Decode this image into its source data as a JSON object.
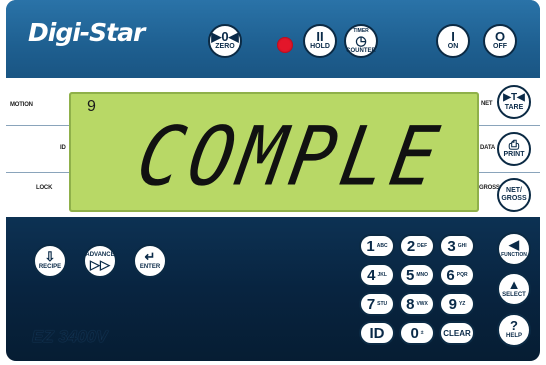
{
  "brand": {
    "logo": "Digi-Star"
  },
  "top_buttons": {
    "zero": {
      "symbol": "▶0◀",
      "label": "ZERO"
    },
    "hold": {
      "symbol": "II",
      "label": "HOLD"
    },
    "timer": {
      "top": "TIMER",
      "label": "COUNTER"
    },
    "on": {
      "symbol": "I",
      "label": "ON"
    },
    "off": {
      "symbol": "O",
      "label": "OFF"
    }
  },
  "indicators": {
    "motion": "MOTION",
    "id": "ID",
    "lock": "LOCK",
    "net": "NET",
    "data": "DATA",
    "gross": "GROSS"
  },
  "display": {
    "small_digit": "9",
    "main_text": "COMPLE"
  },
  "right_buttons": {
    "tare": {
      "symbol": "▶T◀",
      "label": "TARE"
    },
    "print": {
      "symbol": "⎙",
      "label": "PRINT"
    },
    "netgross": {
      "top": "NET/",
      "label": "GROSS"
    }
  },
  "bottom_left_buttons": {
    "recipe": {
      "symbol": "⇩",
      "label": "RECIPE"
    },
    "advance": {
      "top": "ADVANCE",
      "symbol": "▷▷"
    },
    "enter": {
      "symbol": "↵",
      "label": "ENTER"
    }
  },
  "keypad": [
    {
      "n": "1",
      "s": "ABC"
    },
    {
      "n": "2",
      "s": "DEF"
    },
    {
      "n": "3",
      "s": "GHI"
    },
    {
      "n": "4",
      "s": "JKL"
    },
    {
      "n": "5",
      "s": "MNO"
    },
    {
      "n": "6",
      "s": "PQR"
    },
    {
      "n": "7",
      "s": "STU"
    },
    {
      "n": "8",
      "s": "VWX"
    },
    {
      "n": "9",
      "s": "YZ"
    },
    {
      "n": "ID",
      "s": ""
    },
    {
      "n": "0",
      "s": "±"
    },
    {
      "n": "CLEAR",
      "s": ""
    }
  ],
  "side_buttons": {
    "function": {
      "symbol": "◀",
      "label": "FUNCTION"
    },
    "select": {
      "symbol": "▲",
      "label": "SELECT"
    },
    "help": {
      "symbol": "?",
      "label": "HELP"
    }
  },
  "model": "EZ 3400V"
}
